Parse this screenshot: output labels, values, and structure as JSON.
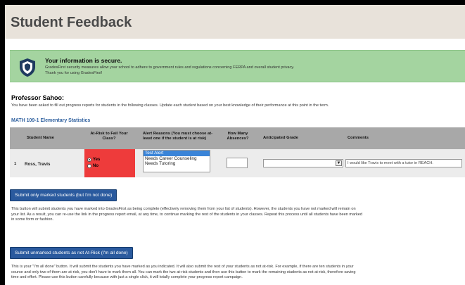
{
  "page": {
    "title": "Student Feedback"
  },
  "security": {
    "icon": "shield-icon",
    "heading": "Your information is secure.",
    "line1": "GradesFirst security measures allow your school to adhere to government rules and regulations concerning FERPA and overall student privacy.",
    "line2": "Thank you for using GradesFirst!"
  },
  "professor": {
    "name": "Professor Sahoo:",
    "intro": "You have been asked to fill out progress reports for students in the following classes. Update each student based on your best knowledge of their performance at this point in the term."
  },
  "course": {
    "name": "MATH 109-1 Elementary Statistics"
  },
  "table": {
    "headers": {
      "student": "Student Name",
      "risk_line1": "At-Risk to Fail Your",
      "risk_line2": "Class?",
      "reasons_line1": "Alert Reasons (You must choose at-",
      "reasons_line2": "least one if the student is at risk)",
      "absences_line1": "How Many",
      "absences_line2": "Absences?",
      "grade": "Anticipated Grade",
      "comments": "Comments"
    },
    "rows": [
      {
        "number": "1",
        "name": "Ross, Travis",
        "risk_yes": "Yes",
        "risk_no": "No",
        "risk_selected": "Yes",
        "reasons": [
          "Test Alert",
          "Needs Career Counseling",
          "Needs Tutoring"
        ],
        "reason_selected": "Test Alert",
        "absences": "",
        "grade": "",
        "comment": "I would like Travis to meet with a tutor in REACH."
      }
    ]
  },
  "actions": {
    "submit_marked": "Submit only marked students (but I'm not done)",
    "submit_marked_desc": [
      "This button will submit students you have marked into GradesFirst as being complete (effectively removing them from your list of students). However, the students you have not marked will remain on",
      "your list. As a result, you can re-use the link in the progress report email, at any time, to continue marking the rest of the students in your classes. Repeat this process until all students have been marked",
      "in some form or fashion."
    ],
    "submit_all": "Submit unmarked students as not At-Risk (I'm all done)",
    "submit_all_desc": [
      "This is your \"I'm all done\" button. It will submit the students you have marked as you indicated. It will also submit the rest of your students as not at-risk. For example, if there are ten students in your",
      "course and only two of them are at-risk, you don't have to mark them all. You can mark the two at-risk students and then use this button to mark the remaining students as not at-risk, therefore saving",
      "time and effort. Please use this button carefully because with just a single click, it will totally complete your progress report campaign."
    ]
  },
  "colors": {
    "security_bg": "#a4d4a0",
    "at_risk_bg": "#ee3b3b",
    "button_bg": "#2a5a9e",
    "course_link": "#2d5f9e"
  }
}
